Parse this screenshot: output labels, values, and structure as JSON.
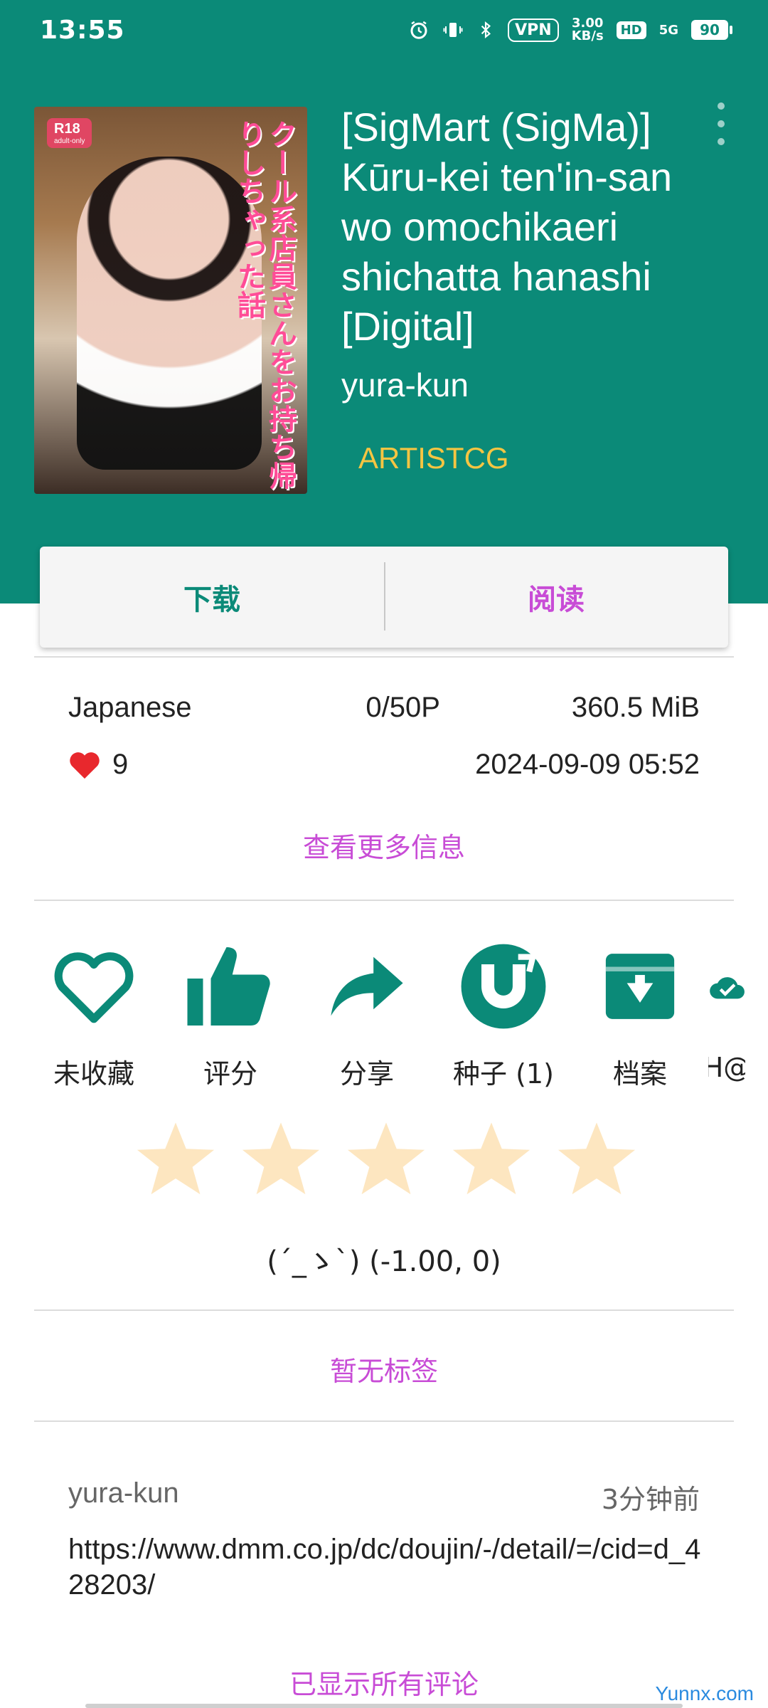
{
  "status_bar": {
    "time": "13:55",
    "vpn": "VPN",
    "net_speed_value": "3.00",
    "net_speed_unit": "KB/s",
    "hd": "HD",
    "signal": "5G",
    "battery": "90"
  },
  "gallery": {
    "cover_badge": "R18",
    "cover_badge_sub": "adult-only",
    "cover_text": "クール系店員さんをお持ち帰りしちゃった話",
    "title": "[SigMart (SigMa)] Kūru-kei ten'in-san wo omochikaeri shichatta hanashi [Digital]",
    "uploader": "yura-kun",
    "category": "ARTISTCG"
  },
  "actions_primary": {
    "download": "下载",
    "read": "阅读"
  },
  "info": {
    "language": "Japanese",
    "pages": "0/50P",
    "size": "360.5 MiB",
    "favorites": "9",
    "posted": "2024-09-09 05:52",
    "more_info": "查看更多信息"
  },
  "actions": [
    {
      "label": "未收藏",
      "icon": "heart-outline-icon"
    },
    {
      "label": "评分",
      "icon": "thumbs-up-icon"
    },
    {
      "label": "分享",
      "icon": "share-icon"
    },
    {
      "label": "种子 (1)",
      "icon": "torrent-icon"
    },
    {
      "label": "档案",
      "icon": "archive-icon"
    },
    {
      "label": "H@",
      "icon": "cloud-check-icon"
    }
  ],
  "rating": {
    "stars": 0,
    "text": "(´_ゝ`) (-1.00, 0)"
  },
  "tags": {
    "empty_text": "暂无标签"
  },
  "comment": {
    "user": "yura-kun",
    "time": "3分钟前",
    "body": "https://www.dmm.co.jp/dc/doujin/-/detail/=/cid=d_428203/"
  },
  "comments_footer": "已显示所有评论",
  "watermark": "Yunnx.com",
  "colors": {
    "primary": "#0b8a78",
    "accent": "#c84cd6",
    "category": "#f5c542",
    "star": "#fde6c0"
  }
}
